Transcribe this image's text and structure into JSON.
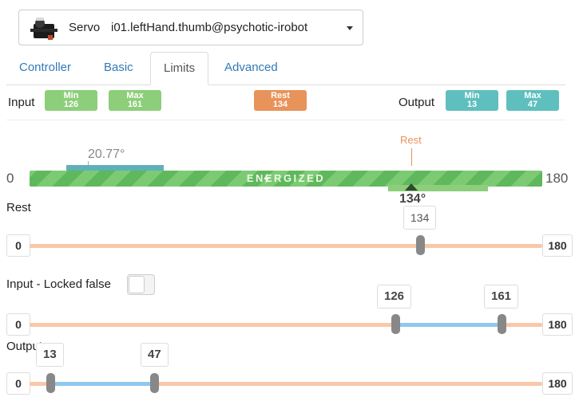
{
  "servo": {
    "label": "Servo",
    "name": "i01.leftHand.thumb@psychotic-irobot",
    "icon": "servo-motor-icon"
  },
  "tabs": [
    {
      "label": "Controller",
      "active": false
    },
    {
      "label": "Basic",
      "active": false
    },
    {
      "label": "Limits",
      "active": true
    },
    {
      "label": "Advanced",
      "active": false
    }
  ],
  "limits_row": {
    "input_label": "Input",
    "output_label": "Output",
    "input_min": {
      "title": "Min",
      "value": "126"
    },
    "input_max": {
      "title": "Max",
      "value": "161"
    },
    "rest": {
      "title": "Rest",
      "value": "134"
    },
    "output_min": {
      "title": "Min",
      "value": "13"
    },
    "output_max": {
      "title": "Max",
      "value": "47"
    }
  },
  "status_bar": {
    "min_label": "0",
    "max_label": "180",
    "status_text": "ENERGIZED",
    "current_position": "20.77°",
    "rest_caption": "Rest",
    "rest_position": "134°"
  },
  "rest_slider": {
    "label": "Rest",
    "min": "0",
    "max": "180",
    "value": "134"
  },
  "input_slider": {
    "label": "Input - Locked false",
    "locked": false,
    "min": "0",
    "max": "180",
    "low": "126",
    "high": "161"
  },
  "output_slider": {
    "label": "Output",
    "min": "0",
    "max": "180",
    "low": "13",
    "high": "47"
  },
  "colors": {
    "min_max_badge": "#8cce7a",
    "rest_badge": "#e8935a",
    "output_badge": "#5fbfbf",
    "energized_bar": "#5fb85c",
    "slider_track": "#f8c8a8",
    "slider_selection": "#8ec8ee",
    "link": "#337ab7"
  }
}
